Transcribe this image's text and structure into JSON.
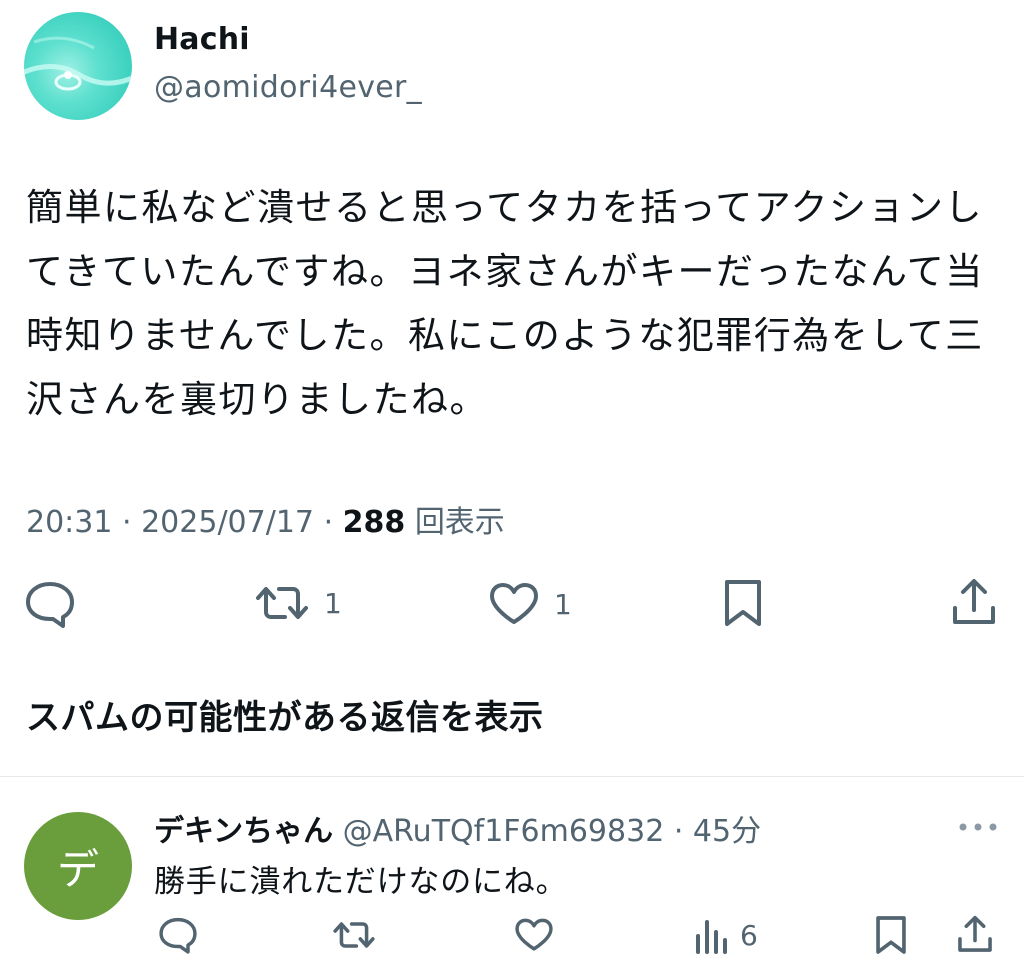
{
  "tweet": {
    "author_name": "Hachi",
    "author_handle": "@aomidori4ever_",
    "body": "簡単に私など潰せると思ってタカを括ってアクションしてきていたんですね。ヨネ家さんがキーだったなんて当時知りませんでした。私にこのような犯罪行為をして三沢さんを裏切りましたね。",
    "time": "20:31",
    "date": "2025/07/17",
    "views_count": "288",
    "views_label": "回表示",
    "actions": {
      "reply_icon": "comment-icon",
      "retweet_icon": "retweet-icon",
      "retweet_count": "1",
      "like_icon": "heart-icon",
      "like_count": "1",
      "bookmark_icon": "bookmark-icon",
      "share_icon": "share-icon"
    }
  },
  "spam_replies_link": "スパムの可能性がある返信を表示",
  "reply": {
    "avatar_letter": "デ",
    "avatar_color": "#6a9e3c",
    "author_name": "デキンちゃん",
    "author_handle": "@ARuTQf1F6m69832",
    "time_ago": "45分",
    "text": "勝手に潰れただけなのにね。",
    "views_count": "6"
  },
  "colors": {
    "text_primary": "#0f1419",
    "text_secondary": "#536471",
    "avatar_main": "#3fd2c0"
  }
}
